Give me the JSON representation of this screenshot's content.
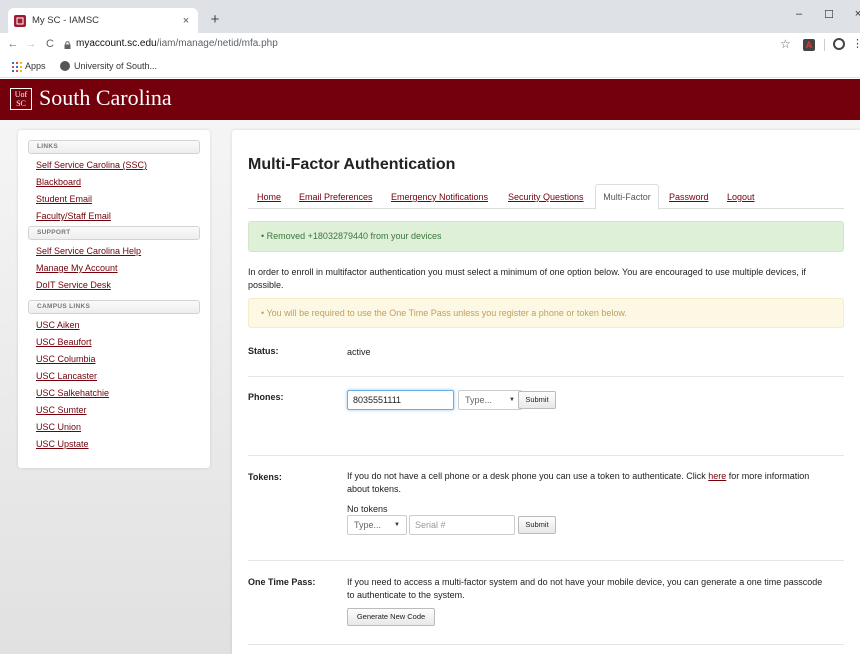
{
  "browser": {
    "tab_title": "My SC - IAMSC",
    "tab_close": "×",
    "new_tab": "+",
    "window_minimize": "–",
    "window_maximize": "☐",
    "window_close": "×",
    "url_host": "myaccount.sc.edu",
    "url_path": "/iam/manage/netid/mfa.php",
    "bookmarks": [
      "Apps",
      "University of South..."
    ]
  },
  "header": {
    "logo_text_top": "Uof",
    "logo_text_bottom": "SC",
    "title": "South Carolina"
  },
  "sidebar": {
    "sections": [
      {
        "heading": "LINKS",
        "links": [
          "Self Service Carolina (SSC)",
          "Blackboard",
          "Student Email",
          "Faculty/Staff Email"
        ]
      },
      {
        "heading": "SUPPORT",
        "links": [
          "Self Service Carolina Help",
          "Manage My Account",
          "DoIT Service Desk"
        ]
      },
      {
        "heading": "CAMPUS LINKS",
        "links": [
          "USC Aiken",
          "USC Beaufort",
          "USC Columbia",
          "USC Lancaster",
          "USC Salkehatchie",
          "USC Sumter",
          "USC Union",
          "USC Upstate"
        ]
      }
    ]
  },
  "main": {
    "title": "Multi-Factor Authentication",
    "tabs": [
      "Home",
      "Email Preferences",
      "Emergency Notifications",
      "Security Questions",
      "Multi-Factor",
      "Password",
      "Logout"
    ],
    "active_tab": "Multi-Factor",
    "success_message": "•  Removed +18032879440 from your devices",
    "intro": "In order to enroll in multifactor authentication you must select a minimum of one option below. You are encouraged to use multiple devices, if possible.",
    "warning_message": "•  You will be required to use the One Time Pass unless you register a phone or token below.",
    "status": {
      "label": "Status:",
      "value": "active"
    },
    "phones": {
      "label": "Phones:",
      "input_value": "8035551111",
      "type_select": "Type...",
      "submit": "Submit"
    },
    "tokens": {
      "label": "Tokens:",
      "description_before": "If you do not have a cell phone or a desk phone you can use a token to authenticate. Click ",
      "link": "here",
      "description_after": " for more information about tokens.",
      "empty_text": "No tokens",
      "type_select": "Type...",
      "serial_placeholder": "Serial #",
      "submit": "Submit"
    },
    "otp": {
      "label": "One Time Pass:",
      "description": "If you need to access a multi-factor system and do not have your mobile device, you can generate a one time passcode to authenticate to the system.",
      "button": "Generate New Code"
    }
  },
  "colors": {
    "brand": "#73000a",
    "success_bg": "#dff0d8",
    "warning_bg": "#fcf8e3"
  }
}
